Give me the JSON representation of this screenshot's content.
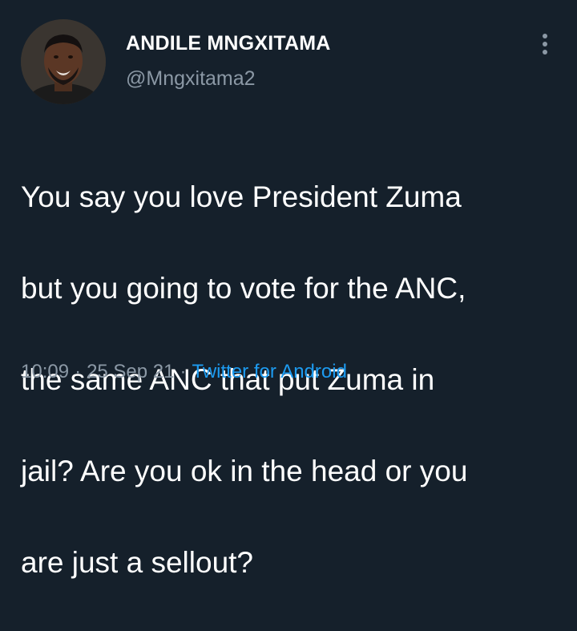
{
  "tweet": {
    "display_name": "ANDILE MNGXITAMA",
    "handle": "@Mngxitama2",
    "text_lines": [
      "You say you love President Zuma",
      "but you going to vote for the ANC,",
      "the same ANC that put Zuma in",
      "jail? Are you ok in the head or you",
      "are just a sellout?"
    ],
    "time": "10:09",
    "date": "25 Sep 21",
    "source": "Twitter for Android",
    "separator": "·"
  },
  "icons": {
    "more": "more-vertical-icon",
    "avatar": "profile-avatar"
  },
  "colors": {
    "background": "#15202b",
    "text_primary": "#ffffff",
    "text_secondary": "#8b98a5",
    "link": "#1d9bf0"
  }
}
